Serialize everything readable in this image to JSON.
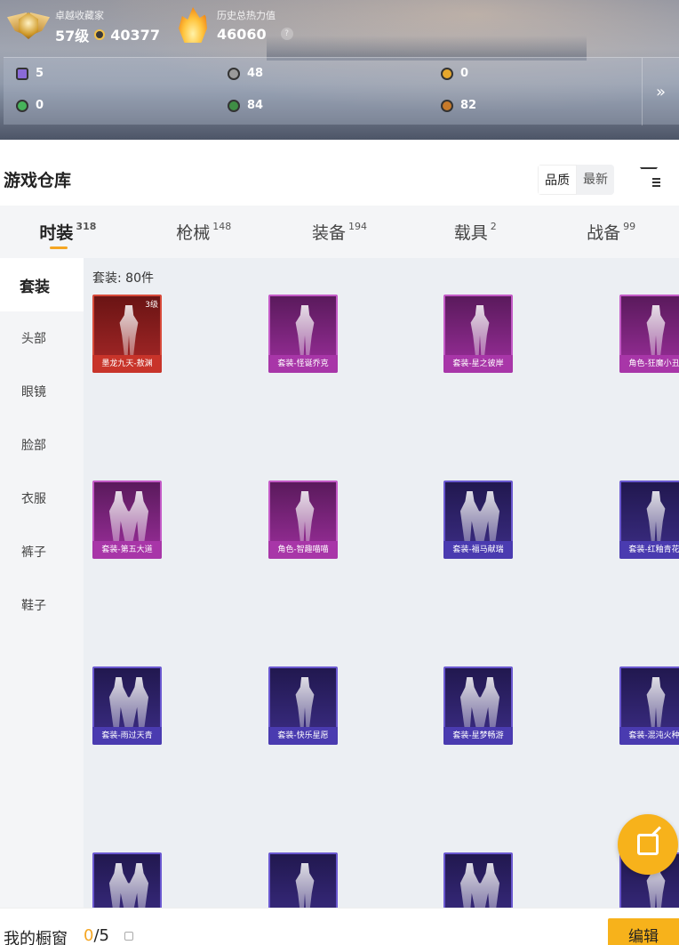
{
  "profile": {
    "rank_title": "卓越收藏家",
    "level": "57级",
    "coins": "40377",
    "heat_title": "历史总热力值",
    "heat_value": "46060",
    "heat_help": "?"
  },
  "resources": [
    {
      "icon": "gem-card-icon",
      "value": "5",
      "color": "#8a6ad8"
    },
    {
      "icon": "silver-coin-icon",
      "value": "48",
      "color": "#9a9a9a"
    },
    {
      "icon": "gold-coin-icon",
      "value": "0",
      "color": "#e7a72c"
    },
    {
      "icon": "green-token-icon",
      "value": "0",
      "color": "#46b35a"
    },
    {
      "icon": "green-orb-icon",
      "value": "84",
      "color": "#3f8e45"
    },
    {
      "icon": "bronze-coin-icon",
      "value": "82",
      "color": "#c77a2a"
    }
  ],
  "resources_more": "»",
  "warehouse": {
    "title": "游戏仓库",
    "sort_quality": "品质",
    "sort_latest": "最新"
  },
  "tabs": [
    {
      "label": "时装",
      "count": "318"
    },
    {
      "label": "枪械",
      "count": "148"
    },
    {
      "label": "装备",
      "count": "194"
    },
    {
      "label": "载具",
      "count": "2"
    },
    {
      "label": "战备",
      "count": "99"
    }
  ],
  "sidebar": [
    "套装",
    "头部",
    "眼镜",
    "脸部",
    "衣服",
    "裤子",
    "鞋子"
  ],
  "grid": {
    "count_label": "套装: 80件",
    "items": [
      {
        "name": "墨龙九天-敖渊",
        "rarity": "red",
        "level": "3级"
      },
      {
        "name": "套装-怪诞乔克",
        "rarity": "purple",
        "level": ""
      },
      {
        "name": "套装-星之彼岸",
        "rarity": "purple",
        "level": ""
      },
      {
        "name": "角色-狂魔小丑",
        "rarity": "purple",
        "level": ""
      },
      {
        "name": "套装-第五大道",
        "rarity": "purple",
        "level": ""
      },
      {
        "name": "角色-智趣喵喵",
        "rarity": "purple",
        "level": ""
      },
      {
        "name": "套装-福马献瑞",
        "rarity": "blue",
        "level": ""
      },
      {
        "name": "套装-红釉青花",
        "rarity": "blue",
        "level": ""
      },
      {
        "name": "套装-雨过天青",
        "rarity": "blue",
        "level": ""
      },
      {
        "name": "套装-快乐星愿",
        "rarity": "blue",
        "level": ""
      },
      {
        "name": "套装-星梦畅游",
        "rarity": "blue",
        "level": ""
      },
      {
        "name": "套装-混沌火种",
        "rarity": "blue",
        "level": ""
      },
      {
        "name": "",
        "rarity": "blue",
        "level": ""
      },
      {
        "name": "",
        "rarity": "blue",
        "level": ""
      },
      {
        "name": "",
        "rarity": "blue",
        "level": ""
      },
      {
        "name": "",
        "rarity": "blue",
        "level": ""
      }
    ]
  },
  "showcase": {
    "title": "我的橱窗",
    "current": "0",
    "total": "/5",
    "edit_label": "编辑"
  },
  "colors": {
    "accent": "#f7b21b"
  }
}
